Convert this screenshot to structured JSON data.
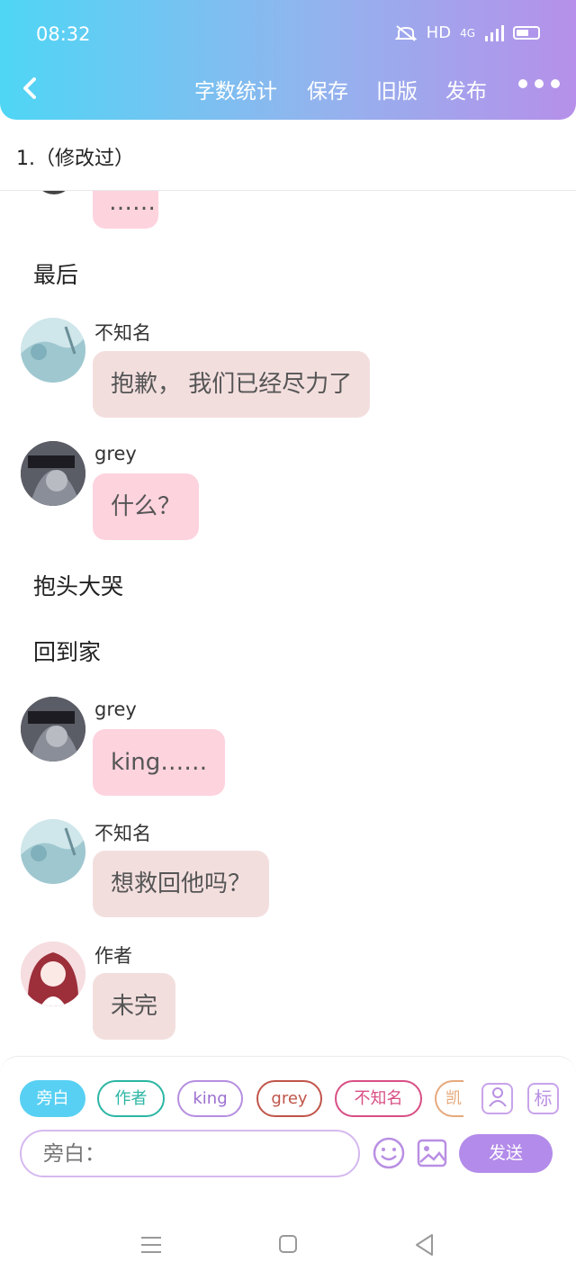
{
  "status_bar": {
    "time": "08:32",
    "network": "HD",
    "signal": "4G"
  },
  "nav": {
    "items": [
      "字数统计",
      "保存",
      "旧版",
      "发布"
    ]
  },
  "doc_title": "1.（修改过）",
  "chat": {
    "top_partial_text": "……",
    "narr1": "最后",
    "msg1": {
      "name": "不知名",
      "text": "抱歉， 我们已经尽力了"
    },
    "msg2": {
      "name": "grey",
      "text": "什么？"
    },
    "narr2": "抱头大哭",
    "narr3": "回到家",
    "msg3": {
      "name": "grey",
      "text": "king……"
    },
    "msg4": {
      "name": "不知名",
      "text": "想救回他吗？"
    },
    "msg5": {
      "name": "作者",
      "text": "未完"
    }
  },
  "role_chips": [
    "旁白",
    "作者",
    "king",
    "grey",
    "不知名",
    "凯"
  ],
  "tool_icons": {
    "role_icon": "person-icon",
    "tag_label": "标"
  },
  "input": {
    "placeholder": "旁白："
  },
  "send_label": "发送",
  "colors": {
    "header_start": "#4fd6f5",
    "header_end": "#b690ea",
    "chip_active": "#58d0f3",
    "send": "#b38bea",
    "bubble_pink": "#fdd3de",
    "bubble_gray": "#f3dede"
  }
}
